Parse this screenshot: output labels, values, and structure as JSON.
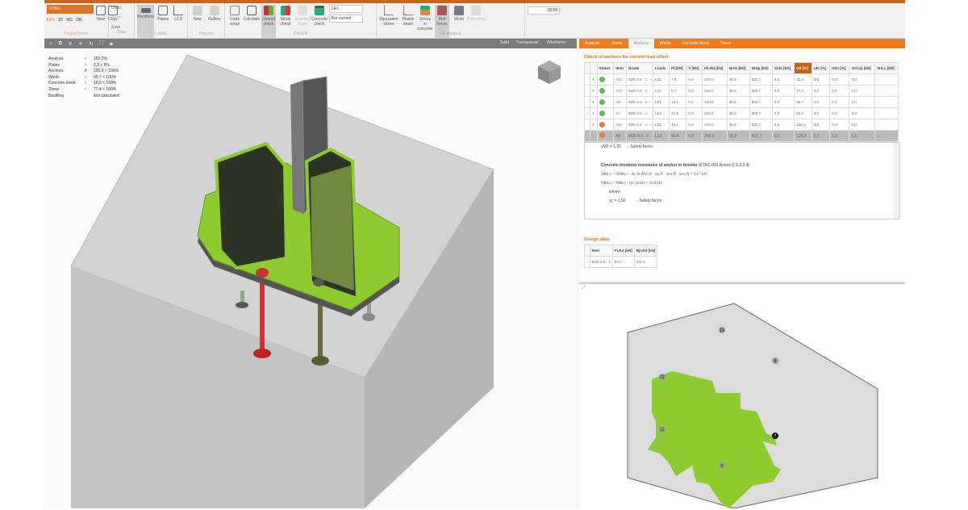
{
  "ribbon": {
    "combo": "CON1",
    "project_items": [
      "EPS",
      "ST",
      "MC",
      "DR"
    ],
    "groups": [
      {
        "label": "Project items",
        "buttons": [
          "New",
          "Copy"
        ]
      },
      {
        "label": "Data",
        "buttons": [
          "Undo",
          "Redo",
          "Save"
        ]
      },
      {
        "label": "Labels",
        "buttons": [
          "Members",
          "Plates",
          "LCS"
        ]
      },
      {
        "label": "Pictures",
        "buttons": [
          "New",
          "Gallery"
        ]
      },
      {
        "label": "CBFEM",
        "buttons": [
          "Code setup",
          "Calculate",
          "Overall check",
          "Strain check",
          "Buckling shape",
          "Concrete check"
        ]
      },
      {
        "label": "FE analysis",
        "buttons": [
          "Equivalent stress",
          "Plastic strain",
          "Stress in concrete",
          "Bolt forces",
          "Mesh",
          "Deformed"
        ]
      }
    ],
    "load_case": "LE1",
    "load_mode": "For current",
    "scale_value": "10,00"
  },
  "view_toolbar": {
    "icons": [
      "home-icon",
      "zoom-window-icon",
      "zoom-icon",
      "pan-icon",
      "rotate-icon",
      "fit-icon",
      "eraser-icon"
    ],
    "modes": [
      "Solid",
      "Transparent",
      "Wireframe"
    ]
  },
  "results": [
    {
      "name": "Analysis",
      "status": "ok",
      "value": "100,0%"
    },
    {
      "name": "Plates",
      "status": "ok",
      "value": "0,3 < 5%"
    },
    {
      "name": "Anchors",
      "status": "fail",
      "value": "126,9 > 100%"
    },
    {
      "name": "Welds",
      "status": "ok",
      "value": "99,7 < 100%"
    },
    {
      "name": "Concrete block",
      "status": "ok",
      "value": "10,5 < 100%"
    },
    {
      "name": "Shear",
      "status": "ok",
      "value": "77,4 < 100%"
    },
    {
      "name": "Buckling",
      "status": "none",
      "value": "Not calculated"
    }
  ],
  "colors": {
    "ok": "#5cb85c",
    "fail": "#e8774a",
    "accent": "#f07a1e",
    "plate": "#8ccc2e"
  },
  "panel": {
    "tabs": [
      "Analysis",
      "Plates",
      "Anchors",
      "Welds",
      "Concrete block",
      "Shear"
    ],
    "active_tab": "Anchors",
    "title": "Check of anchors for current load effect",
    "columns": [
      "Status",
      "Item",
      "Grade",
      "Loads",
      "Ft [kN]",
      "V [kN]",
      "Fb.Rd [kN]",
      "Nrdc [kN]",
      "Nrdp [kN]",
      "Vrds [kN]",
      "Utt [%]",
      "Uts [%]",
      "Utts [%]",
      "Vrd.cp [kN]",
      "Vrd.c [kN]"
    ],
    "rows": [
      {
        "status": "ok",
        "cells": [
          "A10",
          "M20 4.6 - 1",
          "LE1",
          "7,9",
          "0,0",
          "240,0",
          "35,8",
          "502,7",
          "0,0",
          "22,2",
          "0,0",
          "0,0",
          "0,0",
          "-"
        ]
      },
      {
        "status": "ok",
        "cells": [
          "A12",
          "M20 4.6 - 1",
          "LE1",
          "9,7",
          "0,0",
          "240,0",
          "35,8",
          "502,7",
          "0,0",
          "27,2",
          "0,0",
          "0,0",
          "0,0",
          "-"
        ]
      },
      {
        "status": "ok",
        "cells": [
          "A8",
          "M20 4.6 - 1",
          "LE1",
          "13,1",
          "0,0",
          "240,0",
          "35,8",
          "502,7",
          "0,0",
          "36,7",
          "0,0",
          "0,0",
          "0,0",
          "-"
        ]
      },
      {
        "status": "ok",
        "cells": [
          "A7",
          "M20 4.6 - 1",
          "LE1",
          "22,9",
          "0,0",
          "240,0",
          "35,8",
          "502,7",
          "0,0",
          "63,9",
          "0,0",
          "0,0",
          "0,0",
          "-"
        ]
      },
      {
        "status": "fail",
        "cells": [
          "A11",
          "M20 4.6 - 1",
          "LE1",
          "45,1",
          "0,0",
          "240,0",
          "35,8",
          "502,7",
          "0,0",
          "126,1",
          "0,0",
          "0,0",
          "0,0",
          "-"
        ]
      },
      {
        "status": "fail",
        "cells": [
          "A9",
          "M20 4.6 - 1",
          "LE1",
          "45,4",
          "0,0",
          "240,0",
          "35,8",
          "502,7",
          "0,0",
          "126,9",
          "0,0",
          "0,0",
          "0,0",
          "-"
        ]
      }
    ],
    "detail": {
      "line1": "γM2 = 1,25",
      "line1_note": "- Safety factor",
      "heading": "Concrete breakout resistance of anchor in tension",
      "heading_ref": "(ETAG 001 Annex C 5.2.2.4)",
      "eq1": "NRk,c = N0Rk,c · Ac,N/A0c,N · ψs,N · ψre,N · ψec,N =",
      "eq1_value": "53,7  kN",
      "eq2": "NRd,c = NRk,c / (γc·γinst) =",
      "eq2_value": "35,8  kN",
      "where": "where:",
      "line2": "γc = 1,50",
      "line2_note": "- Safety factor"
    },
    "design_title": "Design data",
    "design_columns": [
      "Item",
      "Ft,Rd [kN]",
      "Bp,Rd [kN]"
    ],
    "design_row": [
      "M20 4.6 - 1",
      "60,0",
      "311,2"
    ]
  },
  "anchor_labels": [
    "10",
    "8",
    "12",
    "11",
    "7",
    "9"
  ]
}
